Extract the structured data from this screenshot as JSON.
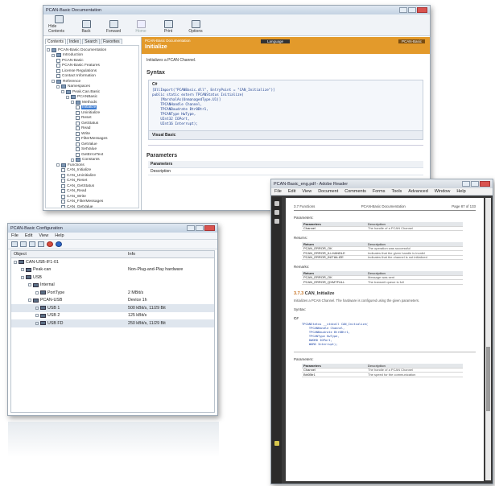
{
  "help": {
    "title": "PCAN-Basic Documentation",
    "toolbar": [
      "Hide Contents",
      "Back",
      "Forward",
      "Home",
      "Print",
      "Options"
    ],
    "nav_tabs": [
      "Contents",
      "Index",
      "Search",
      "Favorites"
    ],
    "tree": [
      {
        "label": "PCAN-Basic Documentation",
        "level": 0,
        "kind": "book"
      },
      {
        "label": "Introduction",
        "level": 1,
        "kind": "book"
      },
      {
        "label": "PCAN-Basic",
        "level": 2,
        "kind": "page"
      },
      {
        "label": "PCAN-Basic Features",
        "level": 2,
        "kind": "page"
      },
      {
        "label": "License Regulations",
        "level": 2,
        "kind": "page"
      },
      {
        "label": "Contact Information",
        "level": 2,
        "kind": "page"
      },
      {
        "label": "Reference",
        "level": 1,
        "kind": "book"
      },
      {
        "label": "Namespaces",
        "level": 2,
        "kind": "book"
      },
      {
        "label": "Peak.Can.Basic",
        "level": 3,
        "kind": "book"
      },
      {
        "label": "PCANBasic",
        "level": 4,
        "kind": "book"
      },
      {
        "label": "Methods",
        "level": 5,
        "kind": "book"
      },
      {
        "label": "Initialize",
        "level": 6,
        "kind": "page",
        "selected": true
      },
      {
        "label": "Uninitialize",
        "level": 6,
        "kind": "page"
      },
      {
        "label": "Reset",
        "level": 6,
        "kind": "page"
      },
      {
        "label": "GetStatus",
        "level": 6,
        "kind": "page"
      },
      {
        "label": "Read",
        "level": 6,
        "kind": "page"
      },
      {
        "label": "Write",
        "level": 6,
        "kind": "page"
      },
      {
        "label": "FilterMessages",
        "level": 6,
        "kind": "page"
      },
      {
        "label": "GetValue",
        "level": 6,
        "kind": "page"
      },
      {
        "label": "SetValue",
        "level": 6,
        "kind": "page"
      },
      {
        "label": "GetErrorText",
        "level": 6,
        "kind": "page"
      },
      {
        "label": "Constants",
        "level": 5,
        "kind": "book"
      },
      {
        "label": "Functions",
        "level": 2,
        "kind": "book"
      },
      {
        "label": "CAN_Initialize",
        "level": 3,
        "kind": "page"
      },
      {
        "label": "CAN_Uninitialize",
        "level": 3,
        "kind": "page"
      },
      {
        "label": "CAN_Reset",
        "level": 3,
        "kind": "page"
      },
      {
        "label": "CAN_GetStatus",
        "level": 3,
        "kind": "page"
      },
      {
        "label": "CAN_Read",
        "level": 3,
        "kind": "page"
      },
      {
        "label": "CAN_Write",
        "level": 3,
        "kind": "page"
      },
      {
        "label": "CAN_FilterMessages",
        "level": 3,
        "kind": "page"
      },
      {
        "label": "CAN_GetValue",
        "level": 3,
        "kind": "page"
      }
    ],
    "content": {
      "breadcrumb": "PCAN-Basic Documentation",
      "page_title": "Initialize",
      "lang_label": "Language",
      "right_label": "PCAN-Basic",
      "description": "Initializes a PCAN Channel.",
      "syntax_heading": "Syntax",
      "code_lang": "C#",
      "code_lines": [
        "[DllImport(\"PCANBasic.dll\", EntryPoint = \"CAN_Initialize\")]",
        "public static extern TPCANStatus Initialize(",
        "    [MarshalAs(UnmanagedType.U1)]",
        "    TPCANHandle Channel,",
        "    TPCANBaudrate Btr0Btr1,",
        "    TPCANType HwType,",
        "    UInt32 IOPort,",
        "    UInt16 Interrupt);"
      ],
      "vb_label": "Visual Basic",
      "params_heading": "Parameters",
      "param_rows": [
        "Parameters",
        "Description"
      ]
    }
  },
  "pcan": {
    "title": "PCAN-Basic Configuration",
    "menu": [
      "File",
      "Edit",
      "View",
      "Help"
    ],
    "columns": [
      "Object",
      "Info"
    ],
    "rows": [
      {
        "indent": 0,
        "name": "CAN-USB-IF1-01",
        "info": ""
      },
      {
        "indent": 1,
        "name": "Peak-can",
        "info": "Non-Plug-and-Play hardware"
      },
      {
        "indent": 1,
        "name": "USB",
        "info": ""
      },
      {
        "indent": 2,
        "name": "Internal",
        "info": ""
      },
      {
        "indent": 3,
        "name": "PortType",
        "info": "2 MBit/s"
      },
      {
        "indent": 2,
        "name": "PCAN-USB",
        "info": "Device 1h"
      },
      {
        "indent": 3,
        "name": "USB 1",
        "info": "500 kBit/s, 11/29 Bit",
        "hl": true
      },
      {
        "indent": 3,
        "name": "USB 2",
        "info": "125 kBit/s"
      },
      {
        "indent": 3,
        "name": "USB FD",
        "info": "250 kBit/s, 11/29 Bit",
        "hl": true
      }
    ]
  },
  "pdf": {
    "title": "PCAN-Basic_eng.pdf - Adobe Reader",
    "menu": [
      "File",
      "Edit",
      "View",
      "Document",
      "Comments",
      "Forms",
      "Tools",
      "Advanced",
      "Window",
      "Help"
    ],
    "header_left": "3.7 Functions",
    "header_center": "PCAN-Basic Documentation",
    "header_right": "Page 87 of 133",
    "sections": [
      {
        "heading": "Parameters:",
        "rows": [
          [
            "Parameters",
            "Description"
          ],
          [
            "Channel",
            "The handle of a PCAN Channel"
          ]
        ]
      },
      {
        "heading": "Returns:",
        "rows": [
          [
            "Return",
            "Description"
          ],
          [
            "PCAN_ERROR_OK",
            "The operation was successful"
          ],
          [
            "PCAN_ERROR_ILLHANDLE",
            "Indicates that the given handle is invalid"
          ],
          [
            "PCAN_ERROR_INITIALIZE",
            "Indicates that the channel is not initialized"
          ]
        ]
      },
      {
        "heading": "Remarks:",
        "rows": [
          [
            "Return",
            "Description"
          ],
          [
            "PCAN_ERROR_OK",
            "Message was sent"
          ],
          [
            "PCAN_ERROR_QXMTFULL",
            "The transmit queue is full"
          ]
        ]
      }
    ],
    "func_number": "3.7.3",
    "func_title": "CAN_Initialize",
    "func_text": "Initializes a PCAN Channel. The hardware is configured using the given parameters.",
    "syntax_label": "Syntax:",
    "code_label": "C#",
    "code_lines": [
      "TPCANStatus __stdcall CAN_Initialize(",
      "    TPCANHandle Channel,",
      "    TPCANBaudrate Btr0Btr1,",
      "    TPCANType HwType,",
      "    DWORD IOPort,",
      "    WORD Interrupt);"
    ],
    "params_label": "Parameters:",
    "param_rows": [
      [
        "Parameters",
        "Description"
      ],
      [
        "Channel",
        "The handle of a PCAN Channel"
      ],
      [
        "Btr0Btr1",
        "The speed for the communication"
      ]
    ]
  }
}
